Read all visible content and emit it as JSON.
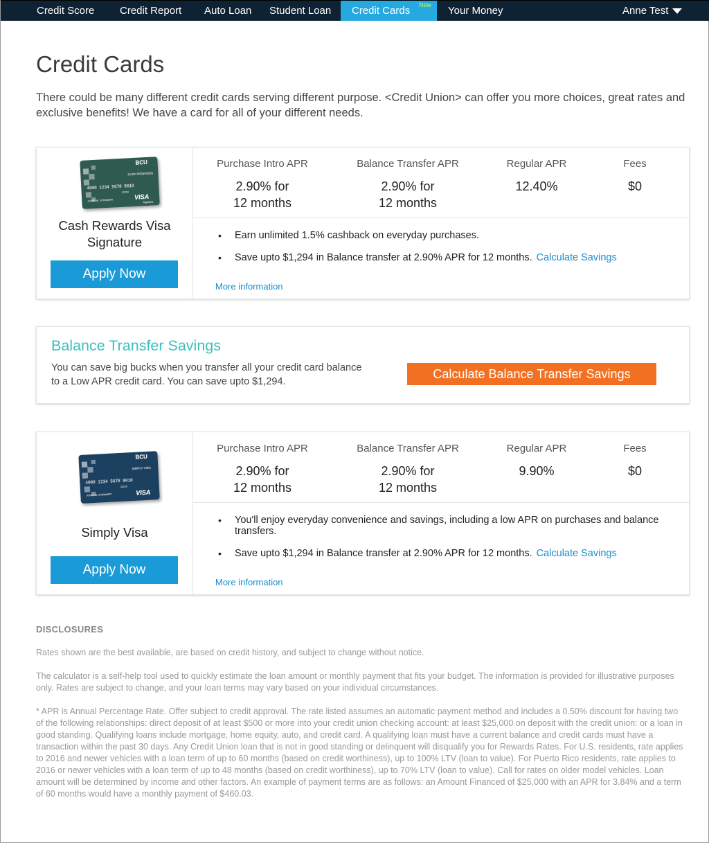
{
  "nav": {
    "items": [
      {
        "label": "Credit Score"
      },
      {
        "label": "Credit Report"
      },
      {
        "label": "Auto Loan"
      },
      {
        "label": "Student Loan"
      },
      {
        "label": "Credit Cards",
        "badge": "New",
        "active": true
      },
      {
        "label": "Your Money"
      }
    ],
    "user": "Anne Test",
    "colors": {
      "bar": "#0e2233",
      "active": "#26a9e0",
      "badge": "#b8ff5a"
    }
  },
  "page": {
    "title": "Credit Cards",
    "intro": "There could be many different credit cards serving different purpose. <Credit Union> can offer you more choices, great rates and exclusive benefits! We have a card for all of your different needs."
  },
  "cards": [
    {
      "name": "Cash Rewards Visa Signature",
      "card_art": {
        "brand": "BCU",
        "product": "CASH REWARDS",
        "number": "4000 1234 5678 9010",
        "expiry": "12/19",
        "holder": "JOHN W. STEWART",
        "network": "VISA",
        "tier": "Signature",
        "color": "#2e5a4f"
      },
      "apply_label": "Apply Now",
      "rates": {
        "purchase_label": "Purchase Intro APR",
        "purchase_line1": "2.90% for",
        "purchase_line2": "12 months",
        "transfer_label": "Balance Transfer APR",
        "transfer_line1": "2.90% for",
        "transfer_line2": "12 months",
        "regular_label": "Regular APR",
        "regular_value": "12.40%",
        "fees_label": "Fees",
        "fees_value": "$0"
      },
      "benefits": [
        "Earn unlimited 1.5% cashback on everyday purchases.",
        "Save upto $1,294 in Balance transfer at 2.90% APR for 12 months."
      ],
      "calc_link": "Calculate Savings",
      "more_info": "More information"
    },
    {
      "name": "Simply Visa",
      "card_art": {
        "brand": "BCU",
        "product": "SIMPLY VISA",
        "number": "4000 1234 5678 9010",
        "expiry": "12/19",
        "holder": "JOHN W. STEWART",
        "network": "VISA",
        "color": "#1f3f5e"
      },
      "apply_label": "Apply Now",
      "rates": {
        "purchase_label": "Purchase Intro APR",
        "purchase_line1": "2.90% for",
        "purchase_line2": "12 months",
        "transfer_label": "Balance Transfer APR",
        "transfer_line1": "2.90% for",
        "transfer_line2": "12 months",
        "regular_label": "Regular APR",
        "regular_value": "9.90%",
        "fees_label": "Fees",
        "fees_value": "$0"
      },
      "benefits": [
        "You'll enjoy everyday convenience and savings, including a low APR on purchases and balance transfers.",
        "Save upto $1,294 in Balance transfer at 2.90% APR for 12 months."
      ],
      "calc_link": "Calculate Savings",
      "more_info": "More information"
    }
  ],
  "balance_transfer": {
    "title": "Balance Transfer Savings",
    "text": "You can save big bucks when you transfer all your credit card balance to a Low APR credit card. You can save upto $1,294.",
    "button": "Calculate Balance Transfer Savings"
  },
  "disclosures": {
    "title": "DISCLOSURES",
    "p1": "Rates shown are the best available, are based on credit history, and subject to change without notice.",
    "p2": "The calculator is a self-help tool used to quickly estimate the loan amount or monthly payment that fits your budget. The information is provided for illustrative purposes only. Rates are subject to change, and your loan terms may vary based on your individual circumstances.",
    "p3": "* APR is Annual Percentage Rate. Offer subject to credit approval. The rate listed assumes an automatic payment method and includes a 0.50% discount for having two of the following relationships: direct deposit of at least $500 or more into your credit union checking account: at least $25,000 on deposit with the credit union: or a loan in good standing. Qualifying loans include mortgage, home equity, auto, and credit card. A qualifying loan must have a current balance and credit cards must have a transaction within the past 30 days. Any Credit Union loan that is not in good standing or delinquent will disqualify you for Rewards Rates. For U.S. residents, rate applies to 2016 and newer vehicles with a loan term of up to 60 months (based on credit worthiness), up to 100% LTV (loan to value). For Puerto Rico residents, rate applies to 2016 or newer vehicles with a loan term of up to 48 months (based on credit worthiness), up to 70% LTV (loan to value). Call for rates on older model vehicles. Loan amount will be determined by income and other factors. An example of payment terms are as follows: an Amount Financed of $25,000 with an APR for 3.84% and a term of 60 months would have a monthly payment of $460.03."
  }
}
